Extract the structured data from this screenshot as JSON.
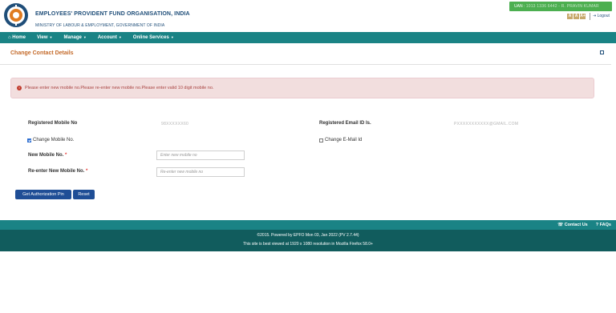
{
  "header": {
    "org_title": "EMPLOYEES' PROVIDENT FUND ORGANISATION, INDIA",
    "org_subtitle": "MINISTRY OF LABOUR & EMPLOYMENT, GOVERNMENT OF INDIA",
    "uan_label": "UAN :",
    "uan_value_masked": "1013 1336 6442 - R. PRAVIN KUMAR",
    "font_controls": [
      "A",
      "A",
      "A+"
    ],
    "logout_label": "Logout"
  },
  "nav": {
    "items": [
      {
        "label": "Home",
        "icon": "home-icon",
        "has_caret": false
      },
      {
        "label": "View",
        "has_caret": true
      },
      {
        "label": "Manage",
        "has_caret": true
      },
      {
        "label": "Account",
        "has_caret": true
      },
      {
        "label": "Online Services",
        "has_caret": true
      }
    ]
  },
  "section": {
    "title": "Change Contact Details"
  },
  "alert": {
    "text": "Please enter new mobile no.Please re-enter new mobile no.Please enter valid 10 digit mobile no."
  },
  "form": {
    "registered_mobile_label": "Registered Mobile No",
    "registered_mobile_value": "98XXXXXX60",
    "registered_email_label": "Registered Email ID Is.",
    "registered_email_value": "PXXXXXXXXXXX@GMAIL.COM",
    "change_mobile_label": "Change Mobile No.",
    "change_mobile_checked": true,
    "change_email_label": "Change E-Mail Id",
    "change_email_checked": false,
    "new_mobile_label": "New Mobile No.",
    "new_mobile_placeholder": "Enter new mobile no",
    "reenter_mobile_label": "Re-enter New Mobile No.",
    "reenter_mobile_placeholder": "Re-enter new mobile no",
    "required_mark": "*",
    "get_pin_button": "Get Authorization Pin",
    "reset_button": "Reset"
  },
  "footer": {
    "contact_label": "Contact Us",
    "faq_label": "FAQs",
    "line1": "©2015. Powered by EPFO Mon 03, Jan 2022 (PV 2.7.44)",
    "line2": "This site is best viewed at 1920 x 1080 resolution in Mozilla Firefox 58.0+"
  },
  "colors": {
    "teal_bar": "#1a8385",
    "footer_dark": "#115c5d",
    "section_title": "#c46a2a",
    "alert_bg": "#f2dede",
    "alert_text": "#a94442",
    "button_bg": "#1f4e96",
    "uan_badge": "#4caf50"
  }
}
